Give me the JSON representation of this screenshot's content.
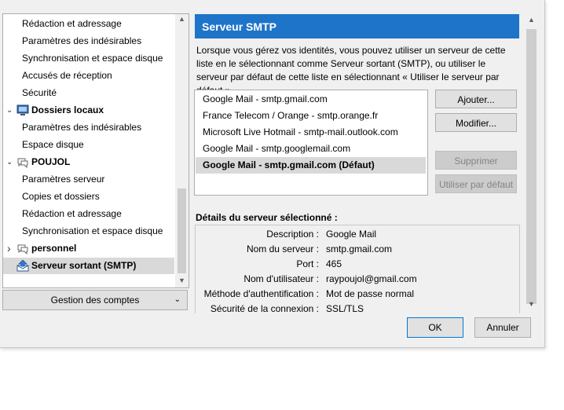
{
  "tree": {
    "items": [
      {
        "label": "Rédaction et adressage",
        "level": 1
      },
      {
        "label": "Paramètres des indésirables",
        "level": 1
      },
      {
        "label": "Synchronisation et espace disque",
        "level": 1
      },
      {
        "label": "Accusés de réception",
        "level": 1
      },
      {
        "label": "Sécurité",
        "level": 1
      },
      {
        "label": "Dossiers locaux",
        "level": 0,
        "icon": "local-folders-icon",
        "chevron": "expanded"
      },
      {
        "label": "Paramètres des indésirables",
        "level": 1
      },
      {
        "label": "Espace disque",
        "level": 1
      },
      {
        "label": "POUJOL",
        "level": 0,
        "icon": "newsgroup-account-icon",
        "chevron": "expanded"
      },
      {
        "label": "Paramètres serveur",
        "level": 1
      },
      {
        "label": "Copies et dossiers",
        "level": 1
      },
      {
        "label": "Rédaction et adressage",
        "level": 1
      },
      {
        "label": "Synchronisation et espace disque",
        "level": 1
      },
      {
        "label": "personnel",
        "level": 0,
        "icon": "newsgroup-account-icon",
        "chevron": "collapsed"
      },
      {
        "label": "Serveur sortant (SMTP)",
        "level": 0,
        "icon": "outgoing-server-icon",
        "selected": true
      }
    ]
  },
  "accounts_button": {
    "label": "Gestion des comptes"
  },
  "smtp": {
    "title": "Serveur SMTP",
    "description": "Lorsque vous gérez vos identités, vous pouvez utiliser un serveur de cette liste en le sélectionnant comme Serveur sortant (SMTP), ou utiliser le serveur par défaut de cette liste en sélectionnant « Utiliser le serveur par défaut ».",
    "servers": [
      {
        "label": "Google Mail - smtp.gmail.com"
      },
      {
        "label": "France Telecom / Orange - smtp.orange.fr"
      },
      {
        "label": "Microsoft Live Hotmail - smtp-mail.outlook.com"
      },
      {
        "label": "Google Mail - smtp.googlemail.com"
      },
      {
        "label": "Google Mail - smtp.gmail.com (Défaut)",
        "selected": true
      }
    ],
    "buttons": {
      "add": "Ajouter...",
      "edit": "Modifier...",
      "remove": "Supprimer",
      "set_default": "Utiliser par défaut"
    },
    "details_title": "Détails du serveur sélectionné :",
    "details": [
      {
        "key": "Description :",
        "value": "Google Mail"
      },
      {
        "key": "Nom du serveur :",
        "value": "smtp.gmail.com"
      },
      {
        "key": "Port :",
        "value": "465"
      },
      {
        "key": "Nom d'utilisateur :",
        "value": "raypoujol@gmail.com"
      },
      {
        "key": "Méthode d'authentification :",
        "value": "Mot de passe normal"
      },
      {
        "key": "Sécurité de la connexion :",
        "value": "SSL/TLS"
      }
    ]
  },
  "footer": {
    "ok": "OK",
    "cancel": "Annuler"
  },
  "colors": {
    "accent": "#1e74c9",
    "selection": "#d9d9d9"
  }
}
